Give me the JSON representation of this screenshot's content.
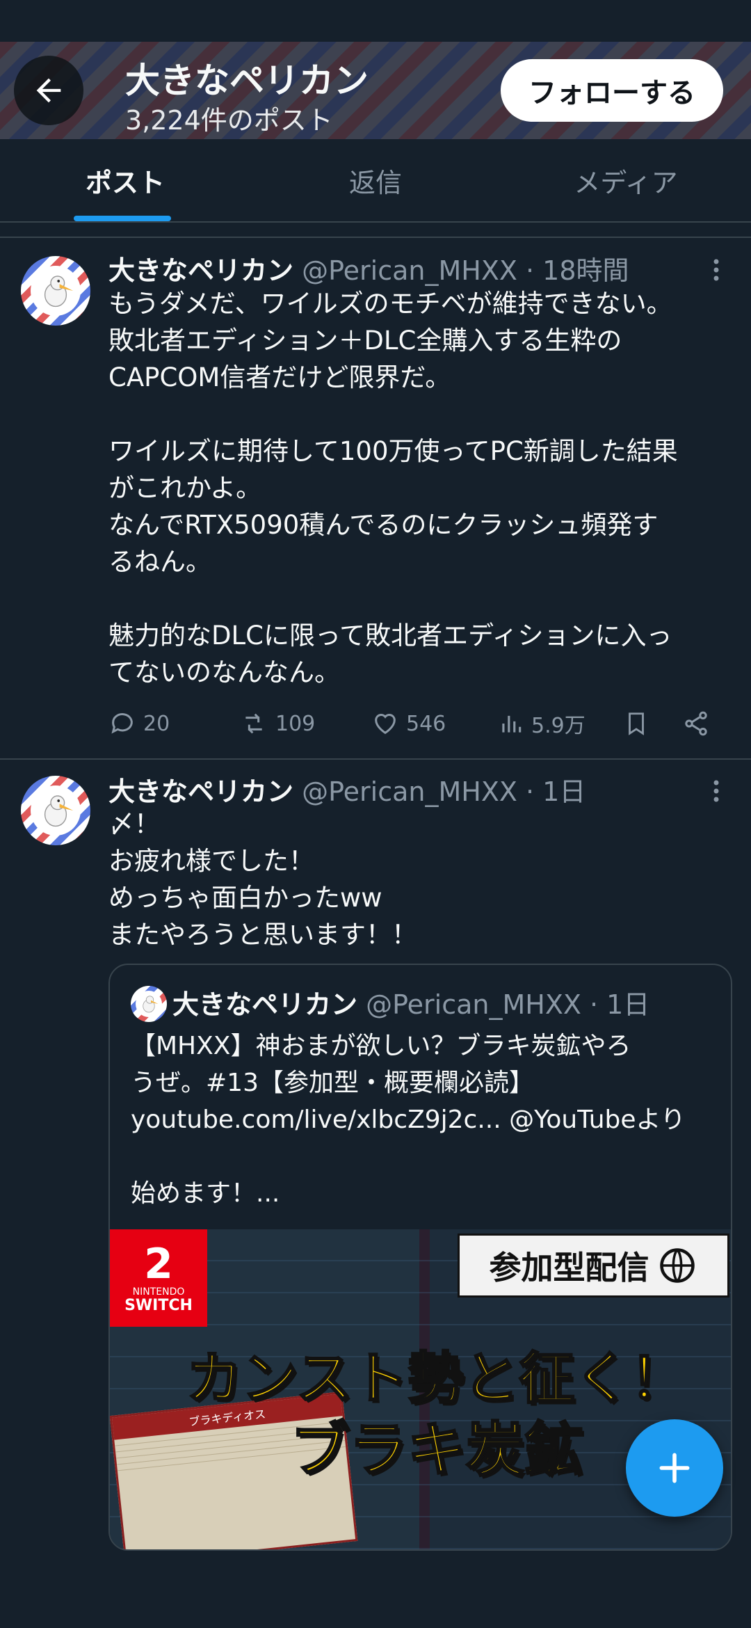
{
  "header": {
    "name": "大きなペリカン",
    "post_count": "3,224件のポスト",
    "follow_label": "フォローする"
  },
  "tabs": [
    {
      "label": "ポスト",
      "active": true
    },
    {
      "label": "返信",
      "active": false
    },
    {
      "label": "メディア",
      "active": false
    }
  ],
  "posts": [
    {
      "author": "大きなペリカン",
      "meta": "@Perican_MHXX · 18時間",
      "text": "もうダメだ、ワイルズのモチベが維持できない。\n敗北者エディション＋DLC全購入する生粋の\nCAPCOM信者だけど限界だ。\n\nワイルズに期待して100万使ってPC新調した結果\nがこれかよ。\nなんでRTX5090積んでるのにクラッシュ頻発す\nるねん。\n\n魅力的なDLCに限って敗北者エディションに入っ\nてないのなんなん。",
      "replies": "20",
      "reposts": "109",
      "likes": "546",
      "views": "5.9万"
    },
    {
      "author": "大きなペリカン",
      "meta": "@Perican_MHXX · 1日",
      "text": "〆！\nお疲れ様でした！\nめっちゃ面白かったww\nまたやろうと思います！！",
      "quote": {
        "author": "大きなペリカン",
        "meta": "@Perican_MHXX · 1日",
        "text": "【MHXX】神おまが欲しい？ブラキ炭鉱やろ\nうぜ。#13【参加型・概要欄必読】\nyoutube.com/live/xlbcZ9j2c... @YouTubeより\n\n始めます！...",
        "thumbnail": {
          "console_num": "2",
          "console_brand": "NINTENDO",
          "console_name": "SWITCH",
          "badge": "参加型配信",
          "headline1": "カンスト勢と征く！",
          "headline2": "ブラキ炭鉱",
          "card_title": "ブラキディオス"
        }
      }
    }
  ],
  "colors": {
    "background": "#15202b",
    "accent": "#1d9bf0",
    "muted": "#8b98a5"
  }
}
